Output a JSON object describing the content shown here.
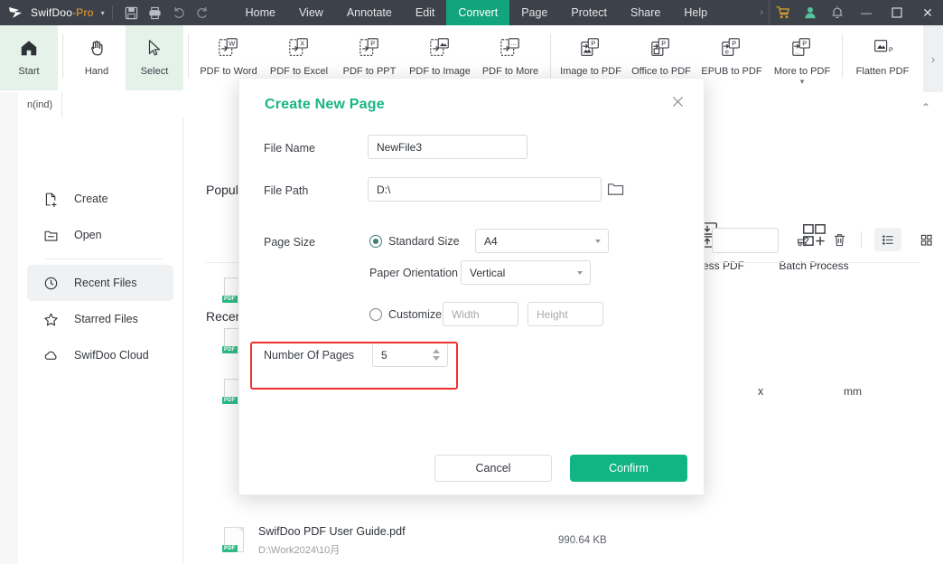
{
  "titlebar": {
    "brand_name": "SwifDoo",
    "brand_suffix": "-Pro",
    "dropdown_caret": "▾",
    "quick_actions": [
      {
        "name": "save-icon",
        "label": "Save"
      },
      {
        "name": "print-icon",
        "label": "Print"
      },
      {
        "name": "undo-icon",
        "label": "Undo"
      },
      {
        "name": "redo-icon",
        "label": "Redo"
      }
    ],
    "menus": [
      {
        "label": "Home",
        "active": false
      },
      {
        "label": "View",
        "active": false
      },
      {
        "label": "Annotate",
        "active": false
      },
      {
        "label": "Edit",
        "active": false
      },
      {
        "label": "Convert",
        "active": true
      },
      {
        "label": "Page",
        "active": false
      },
      {
        "label": "Protect",
        "active": false
      },
      {
        "label": "Share",
        "active": false
      },
      {
        "label": "Help",
        "active": false
      }
    ],
    "overflow_caret": "›",
    "right_icons": [
      {
        "name": "cart-icon",
        "label": "Store"
      },
      {
        "name": "account-icon",
        "label": "Account"
      },
      {
        "name": "bell-icon",
        "label": "Notifications"
      }
    ],
    "window_controls": [
      {
        "name": "minimize-button",
        "glyph": "—"
      },
      {
        "name": "maximize-button",
        "glyph": "▢"
      },
      {
        "name": "close-button",
        "glyph": "✕"
      }
    ],
    "colors": {
      "bar": "#3d4149",
      "active_tab": "#12a47c",
      "pro_accent": "#f0a32a"
    }
  },
  "ribbon": {
    "mode_buttons": [
      {
        "label": "Start",
        "icon": "home-icon",
        "selected": true
      },
      {
        "label": "Hand",
        "icon": "hand-icon",
        "selected": false
      },
      {
        "label": "Select",
        "icon": "cursor-icon",
        "selected": true
      }
    ],
    "convert_from": [
      {
        "label": "PDF to Word",
        "icon": "pdf-to-word-icon",
        "badge": "W"
      },
      {
        "label": "PDF to Excel",
        "icon": "pdf-to-excel-icon",
        "badge": "X"
      },
      {
        "label": "PDF to PPT",
        "icon": "pdf-to-ppt-icon",
        "badge": "P"
      },
      {
        "label": "PDF to Image",
        "icon": "pdf-to-image-icon",
        "badge": "▲"
      },
      {
        "label": "PDF to More",
        "icon": "pdf-to-more-icon",
        "badge": "..."
      }
    ],
    "convert_to": [
      {
        "label": "Image to PDF",
        "icon": "image-to-pdf-icon",
        "badge": "P",
        "sub": ""
      },
      {
        "label": "Office to PDF",
        "icon": "office-to-pdf-icon",
        "badge": "P",
        "sub": ""
      },
      {
        "label": "EPUB to PDF",
        "icon": "epub-to-pdf-icon",
        "badge": "P",
        "sub": ""
      },
      {
        "label": "More to PDF",
        "icon": "more-to-pdf-icon",
        "badge": "P",
        "sub": "▾"
      }
    ],
    "extras": [
      {
        "label": "Flatten PDF",
        "icon": "flatten-pdf-icon"
      }
    ],
    "overflow_caret": "›"
  },
  "workspace": {
    "left_rail_label": "nav-panel",
    "doc_tab_label": "n(ind)",
    "collapse_caret": "⌃"
  },
  "sidebar": {
    "items": [
      {
        "label": "Create",
        "icon": "new-document-icon",
        "active": false
      },
      {
        "label": "Open",
        "icon": "open-folder-icon",
        "active": false
      },
      {
        "label": "Recent Files",
        "icon": "clock-icon",
        "active": true
      },
      {
        "label": "Starred Files",
        "icon": "star-icon",
        "active": false
      },
      {
        "label": "SwifDoo Cloud",
        "icon": "cloud-icon",
        "active": false
      }
    ]
  },
  "main": {
    "popular_tools_title": "Popular Tools",
    "recent_files_title": "Recent Files",
    "tools": [
      {
        "label": "Compress PDF",
        "icon": "compress-pdf-icon"
      },
      {
        "label": "Batch Process",
        "icon": "batch-process-icon"
      }
    ],
    "toolbar": {
      "search_placeholder": "",
      "icons": [
        {
          "name": "clear-history-icon",
          "label": "Clear"
        },
        {
          "name": "trash-icon",
          "label": "Delete"
        },
        {
          "name": "list-view-icon",
          "label": "List view",
          "selected": true
        },
        {
          "name": "grid-view-icon",
          "label": "Grid view",
          "selected": false
        }
      ]
    },
    "files": [
      {
        "name": "SwifDoo PDF User Guide.pdf",
        "path": "D:\\Work2024\\10月",
        "size": "990.64 KB",
        "type": "PDF"
      }
    ],
    "hidden_rows_count": 3
  },
  "dialog": {
    "title": "Create New Page",
    "close_glyph": "✕",
    "fields": {
      "file_name_label": "File Name",
      "file_name_value": "NewFile3",
      "file_path_label": "File Path",
      "file_path_value": "D:\\",
      "browse_icon": "folder-icon",
      "page_size_label": "Page Size",
      "standard_size_label": "Standard Size",
      "standard_size_selected": true,
      "standard_size_value": "A4",
      "paper_orientation_label": "Paper Orientation",
      "paper_orientation_value": "Vertical",
      "customize_label": "Customize",
      "customize_selected": false,
      "width_placeholder": "Width",
      "width_value": "",
      "multiply_symbol": "x",
      "height_placeholder": "Height",
      "height_value": "",
      "unit_label": "mm",
      "number_of_pages_label": "Number Of Pages",
      "number_of_pages_value": "5"
    },
    "buttons": {
      "cancel_label": "Cancel",
      "confirm_label": "Confirm"
    },
    "highlight_color": "#f0302c",
    "accent_color": "#17b585"
  }
}
